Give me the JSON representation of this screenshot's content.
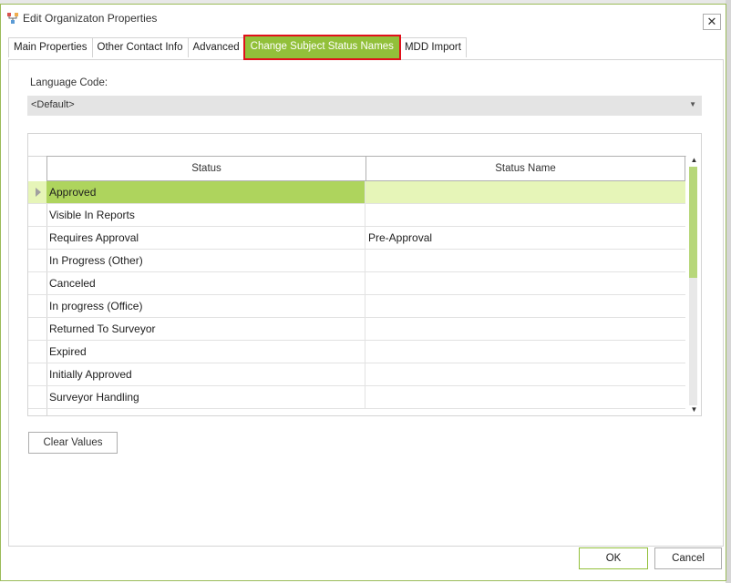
{
  "window": {
    "title": "Edit Organizaton Properties",
    "close_symbol": "✕",
    "app_icon": "org-properties-icon"
  },
  "tabs": [
    {
      "label": "Main Properties",
      "active": false
    },
    {
      "label": "Other Contact Info",
      "active": false
    },
    {
      "label": "Advanced",
      "active": false
    },
    {
      "label": "Change Subject Status Names",
      "active": true
    },
    {
      "label": "MDD Import",
      "active": false
    }
  ],
  "language": {
    "label": "Language Code:",
    "value": "<Default>"
  },
  "grid": {
    "columns": [
      "Status",
      "Status Name"
    ],
    "rows": [
      {
        "status": "Approved",
        "status_name": ""
      },
      {
        "status": "Visible In Reports",
        "status_name": ""
      },
      {
        "status": "Requires Approval",
        "status_name": "Pre-Approval"
      },
      {
        "status": "In Progress (Other)",
        "status_name": ""
      },
      {
        "status": "Canceled",
        "status_name": ""
      },
      {
        "status": "In progress (Office)",
        "status_name": ""
      },
      {
        "status": "Returned To Surveyor",
        "status_name": ""
      },
      {
        "status": "Expired",
        "status_name": ""
      },
      {
        "status": "Initially Approved",
        "status_name": ""
      },
      {
        "status": "Surveyor Handling",
        "status_name": ""
      }
    ],
    "selected_row": 0
  },
  "buttons": {
    "clear_values": "Clear Values",
    "ok": "OK",
    "cancel": "Cancel"
  },
  "colors": {
    "accent": "#92c03a",
    "highlight_outline": "#e0101b",
    "selected_row": "#e6f5b8",
    "selected_cell": "#aed45d"
  }
}
